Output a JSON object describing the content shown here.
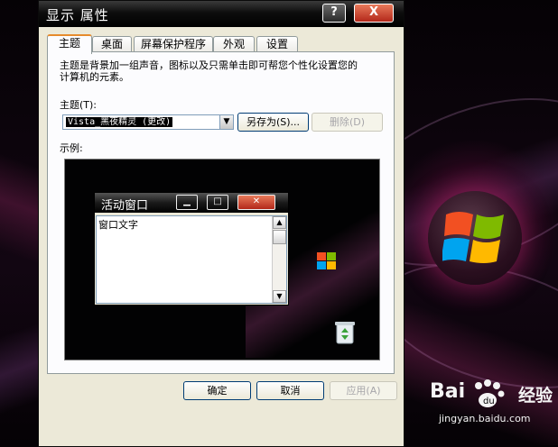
{
  "window": {
    "title": "显示 属性",
    "help_label": "?",
    "close_label": "X"
  },
  "tabs": [
    {
      "label": "主题",
      "active": true
    },
    {
      "label": "桌面",
      "active": false
    },
    {
      "label": "屏幕保护程序",
      "active": false
    },
    {
      "label": "外观",
      "active": false
    },
    {
      "label": "设置",
      "active": false
    }
  ],
  "theme_page": {
    "description": "主题是背景加一组声音，图标以及只需单击即可帮您个性化设置您的计算机的元素。",
    "theme_label": "主题(T):",
    "theme_value": "Vista_黑夜精灵 (更改)",
    "save_as_label": "另存为(S)...",
    "delete_label": "删除(D)",
    "preview_label": "示例:"
  },
  "preview": {
    "active_window_title": "活动窗口",
    "window_text": "窗口文字"
  },
  "buttons": {
    "ok": "确定",
    "cancel": "取消",
    "apply": "应用(A)"
  },
  "watermark": {
    "brand": "Bai",
    "brand2": "经验",
    "url": "jingyan.baidu.com"
  },
  "colors": {
    "title_bar": "#000000",
    "dialog_bg": "#ece9d8",
    "tab_highlight": "#e68b2c",
    "close_button": "#c8391f"
  },
  "icons": [
    "help-icon",
    "close-icon",
    "dropdown-arrow-icon",
    "minimize-icon",
    "maximize-icon",
    "scroll-up-icon",
    "scroll-down-icon",
    "recycle-bin-icon",
    "windows-logo-icon",
    "baidu-paw-icon"
  ]
}
